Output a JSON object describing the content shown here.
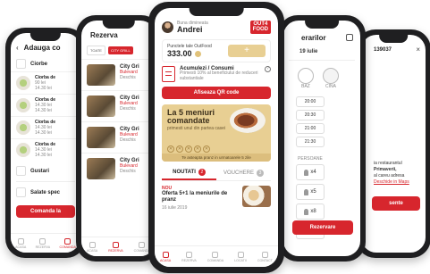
{
  "brand": {
    "accent": "#d7262d",
    "gold": "#e8cf93"
  },
  "phone1": {
    "title": "Adauga co",
    "section1": "Ciorbe",
    "items": [
      {
        "name": "Ciorba de",
        "sub": "90 lei",
        "time": "14.30 lei"
      },
      {
        "name": "Ciorba de",
        "sub": "14.30 lei",
        "time": "14.30 lei"
      },
      {
        "name": "Ciorba de",
        "sub": "14.30 lei",
        "time": "14.30 lei"
      },
      {
        "name": "Ciorba de",
        "sub": "14.30 lei",
        "time": "14.30 lei"
      }
    ],
    "section2": "Gustari",
    "section3": "Salate spec",
    "order_button": "Comanda la",
    "tabs": [
      "ACASA",
      "REZERVA",
      "COMANDA"
    ]
  },
  "phone2": {
    "title": "Rezerva",
    "chip_all": "TOATE",
    "chip_active": "CITY GRILL",
    "restaurants": [
      {
        "name": "City Gri",
        "line1": "Bulevard",
        "line2": "Deschis"
      },
      {
        "name": "City Gri",
        "line1": "Bulevard",
        "line2": "Deschis"
      },
      {
        "name": "City Gri",
        "line1": "Bulevard",
        "line2": "Deschis"
      },
      {
        "name": "City Gri",
        "line1": "Bulevard",
        "line2": "Deschis"
      }
    ],
    "tabs": [
      "ACASA",
      "REZERVA",
      "COMANDA"
    ]
  },
  "home": {
    "greeting": "Buna dimineata",
    "user_name": "Andrei",
    "logo_top": "OUT4",
    "logo_bottom": "FOOD",
    "points_label": "Punctele tale OutFood",
    "points_value": "333.00",
    "promo_title": "Acumulezi / Consumi",
    "promo_text": "Primesti 10% al beneficiului de reduceri substantiale",
    "qr_button": "Afiseaza QR code",
    "offer_line1": "La 5 meniuri",
    "offer_line2": "comandate",
    "offer_sub": "primesti unul din partea casei",
    "offer_dots": [
      "1",
      "2",
      "3",
      "4",
      "5"
    ],
    "offer_footer": "Te asteapta pranz in urmatoarele 5 zile",
    "tab_news": "NOUTATI",
    "news_count": "2",
    "tab_vouchers": "VOUCHERE",
    "voucher_count": "3",
    "news_tag": "NOU",
    "news_title": "Oferta 5+1 la meniurile de pranz",
    "news_date": "16 iulie 2019",
    "nav": [
      "ACASA",
      "REZERVA",
      "COMANDA",
      "LOCATII",
      "CONTACT"
    ]
  },
  "phone4": {
    "title": "erarilor",
    "date": "19 iulie",
    "tile_labels": [
      "BAZ",
      "CINA"
    ],
    "times": [
      "20:00",
      "20:30",
      "21:00",
      "21:30"
    ],
    "persons_label": "PERSOANE",
    "persons": [
      "x4",
      "x5",
      "x8",
      ""
    ],
    "button": "Rezervare"
  },
  "phone5": {
    "code": "139037",
    "line1": "ia restaurantul",
    "line2": "Primaverii,",
    "line3": "al careu adresa",
    "link": "Deschide in Maps",
    "button": "sente"
  }
}
